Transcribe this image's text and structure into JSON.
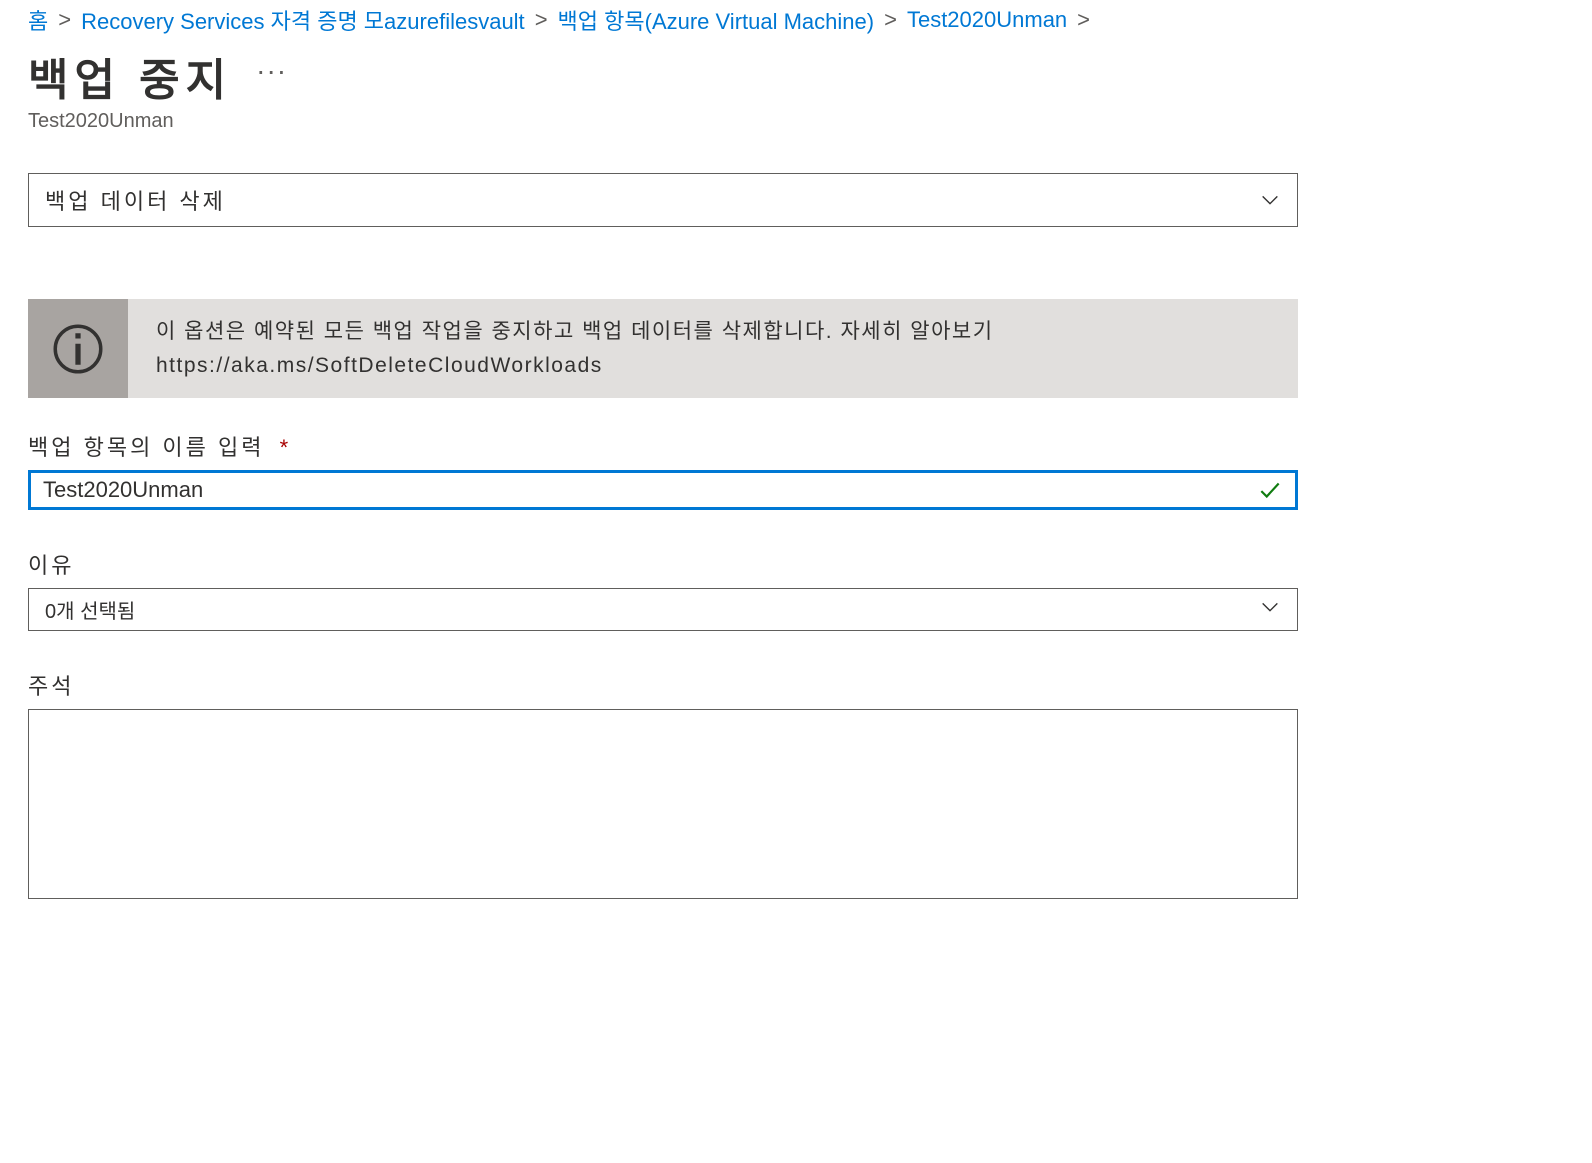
{
  "breadcrumb": {
    "home": "홈",
    "item1a": "Recovery Services 자격 증명 모",
    "item1b": "azurefilesvault",
    "item2": "백업 항목(Azure Virtual Machine)",
    "item3": "Test2020Unman"
  },
  "page": {
    "title": "백업 중지",
    "ellipsis": "···",
    "subtitle": "Test2020Unman"
  },
  "action_dropdown": {
    "selected": "백업 데이터 삭제"
  },
  "info": {
    "text": "이 옵션은 예약된 모든 백업 작업을 중지하고 백업 데이터를 삭제합니다. 자세히 알아보기 https://aka.ms/SoftDeleteCloudWorkloads"
  },
  "form": {
    "name_label": "백업 항목의 이름 입력",
    "required_marker": "*",
    "name_value": "Test2020Unman",
    "reason_label": "이유",
    "reason_selected": "0개 선택됨",
    "comment_label": "주석",
    "comment_value": ""
  }
}
